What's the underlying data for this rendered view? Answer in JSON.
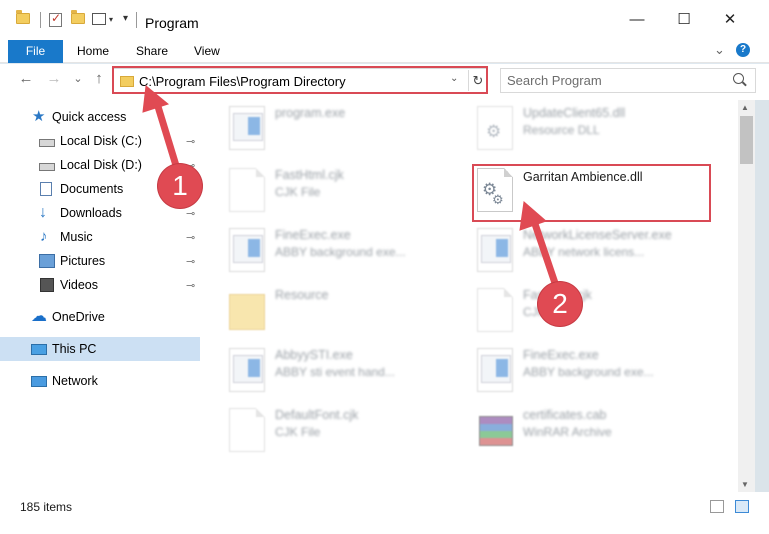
{
  "window": {
    "title": "Program",
    "minimize_icon": "—",
    "maximize_icon": "☐",
    "close_icon": "✕"
  },
  "ribbon": {
    "tabs": [
      "File",
      "Home",
      "Share",
      "View"
    ],
    "expand_icon": "⌄",
    "help_icon": "?"
  },
  "nav": {
    "back_icon": "←",
    "forward_icon": "→",
    "recent_icon": "⌄",
    "up_icon": "↑",
    "address": "C:\\Program Files\\Program Directory",
    "address_dropdown_icon": "⌄",
    "refresh_icon": "↻",
    "search_placeholder": "Search Program"
  },
  "sidebar": {
    "items": [
      {
        "label": "Quick access",
        "icon": "star-icon",
        "pinned": false,
        "selected": false
      },
      {
        "label": "Local Disk (C:)",
        "icon": "drive-icon",
        "pinned": true,
        "selected": false
      },
      {
        "label": "Local Disk (D:)",
        "icon": "drive-icon",
        "pinned": true,
        "selected": false
      },
      {
        "label": "Documents",
        "icon": "documents-icon",
        "pinned": true,
        "selected": false
      },
      {
        "label": "Downloads",
        "icon": "downloads-icon",
        "pinned": true,
        "selected": false
      },
      {
        "label": "Music",
        "icon": "music-icon",
        "pinned": true,
        "selected": false
      },
      {
        "label": "Pictures",
        "icon": "pictures-icon",
        "pinned": true,
        "selected": false
      },
      {
        "label": "Videos",
        "icon": "videos-icon",
        "pinned": true,
        "selected": false
      },
      {
        "label": "OneDrive",
        "icon": "onedrive-icon",
        "pinned": false,
        "selected": false
      },
      {
        "label": "This PC",
        "icon": "this-pc-icon",
        "pinned": false,
        "selected": true
      },
      {
        "label": "Network",
        "icon": "network-icon",
        "pinned": false,
        "selected": false
      }
    ],
    "pin_icon": "📌"
  },
  "files": {
    "left": [
      {
        "name": "program.exe",
        "type": "",
        "icon": "exe-icon"
      },
      {
        "name": "FastHtml.cjk",
        "type": "CJK File",
        "icon": "file-icon"
      },
      {
        "name": "FineExec.exe",
        "type": "ABBY background exe...",
        "icon": "exe-icon"
      },
      {
        "name": "Resource",
        "type": "",
        "icon": "folder-icon"
      },
      {
        "name": "AbbyySTI.exe",
        "type": "ABBY sti event hand...",
        "icon": "exe-icon"
      },
      {
        "name": "DefaultFont.cjk",
        "type": "CJK File",
        "icon": "file-icon"
      }
    ],
    "right": [
      {
        "name": "UpdateClient65.dll",
        "type": "Resource DLL",
        "icon": "dll-icon"
      },
      {
        "name": "Garritan Ambience.dll",
        "type": "",
        "icon": "dll-gear-icon"
      },
      {
        "name": "NetworkLicenseServer.exe",
        "type": "ABBY network licens...",
        "icon": "exe-icon"
      },
      {
        "name": "FastHtml.cjk",
        "type": "CJK File",
        "icon": "file-icon"
      },
      {
        "name": "FineExec.exe",
        "type": "ABBY background exe...",
        "icon": "exe-icon"
      },
      {
        "name": "certificates.cab",
        "type": "WinRAR Archive",
        "icon": "cab-icon"
      }
    ]
  },
  "status": {
    "item_count": "185 items"
  },
  "annotations": {
    "marker_1": "1",
    "marker_2": "2",
    "highlight_color": "#d94a55"
  }
}
